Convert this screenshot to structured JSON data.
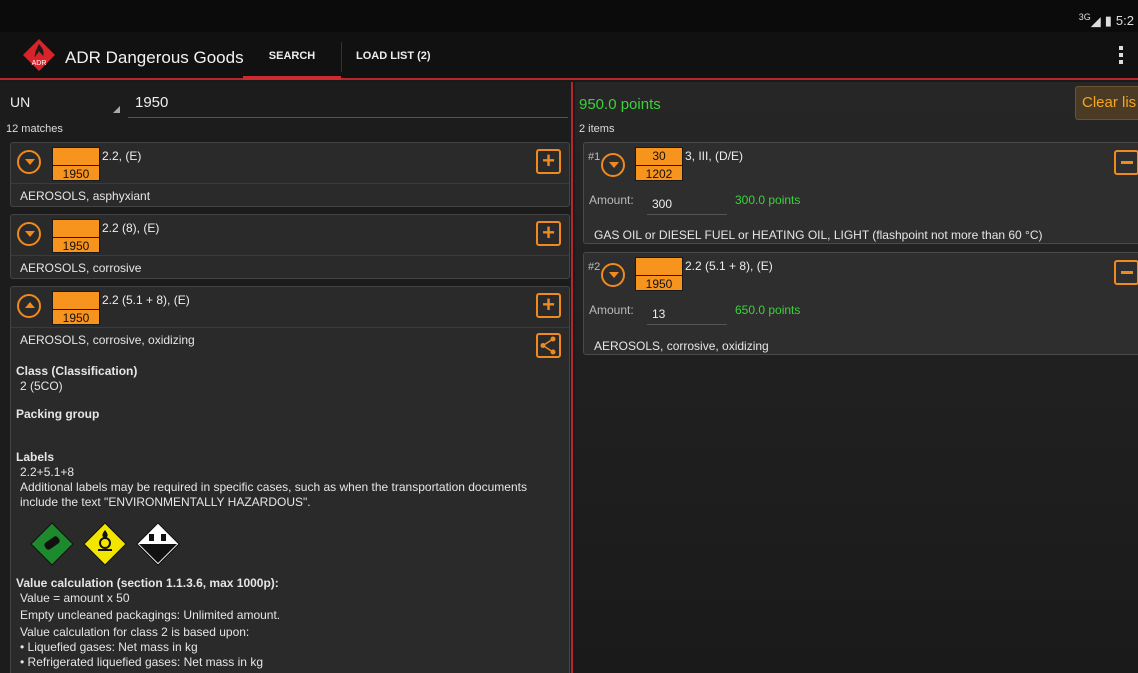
{
  "status": {
    "network": "3G",
    "time": "5:2"
  },
  "app": {
    "title": "ADR Dangerous Goods",
    "logo_text": "ADR"
  },
  "tabs": [
    {
      "label": "SEARCH",
      "selected": true
    },
    {
      "label": "LOAD LIST (2)",
      "selected": false
    }
  ],
  "search": {
    "type": "UN",
    "query": "1950",
    "matches": "12 matches"
  },
  "results": [
    {
      "plate_top": "",
      "un": "1950",
      "class": "2.2, (E)",
      "name": "AEROSOLS, asphyxiant",
      "expanded": false
    },
    {
      "plate_top": "",
      "un": "1950",
      "class": "2.2 (8), (E)",
      "name": "AEROSOLS, corrosive",
      "expanded": false
    },
    {
      "plate_top": "",
      "un": "1950",
      "class": "2.2 (5.1 + 8), (E)",
      "name": "AEROSOLS, corrosive, oxidizing",
      "expanded": true
    }
  ],
  "details": {
    "class_heading": "Class (Classification)",
    "class_value": "2 (5CO)",
    "packing_heading": "Packing group",
    "labels_heading": "Labels",
    "labels_value": "2.2+5.1+8",
    "labels_note": "Additional labels may be required in specific cases, such as when the transportation documents include the text \"ENVIRONMENTALLY HAZARDOUS\".",
    "label_icons": [
      "non-flammable-gas-label-icon",
      "oxidizer-label-icon",
      "corrosive-label-icon"
    ],
    "value_heading": "Value calculation (section 1.1.3.6, max 1000p):",
    "value_lines": [
      "Value = amount x 50",
      "Empty uncleaned packagings: Unlimited amount.",
      "Value calculation for class 2 is based upon:",
      "• Liquefied gases: Net mass in kg",
      "• Refrigerated liquefied gases: Net mass in kg"
    ]
  },
  "load_list": {
    "points": "950.0 points",
    "clear_label": "Clear lis",
    "items_count": "2 items",
    "amount_label": "Amount:",
    "items": [
      {
        "index": "#1",
        "plate_top": "30",
        "un": "1202",
        "class": "3, III, (D/E)",
        "amount": "300",
        "points": "300.0 points",
        "name": "GAS OIL or DIESEL FUEL or HEATING OIL, LIGHT (flashpoint not more than 60 °C)"
      },
      {
        "index": "#2",
        "plate_top": "",
        "un": "1950",
        "class": "2.2 (5.1 + 8), (E)",
        "amount": "13",
        "points": "650.0 points",
        "name": "AEROSOLS, corrosive, oxidizing"
      }
    ]
  },
  "colors": {
    "accent": "#f08a1e",
    "divider": "#b8262b",
    "points": "#3bd23b",
    "plate": "#f7941d"
  }
}
